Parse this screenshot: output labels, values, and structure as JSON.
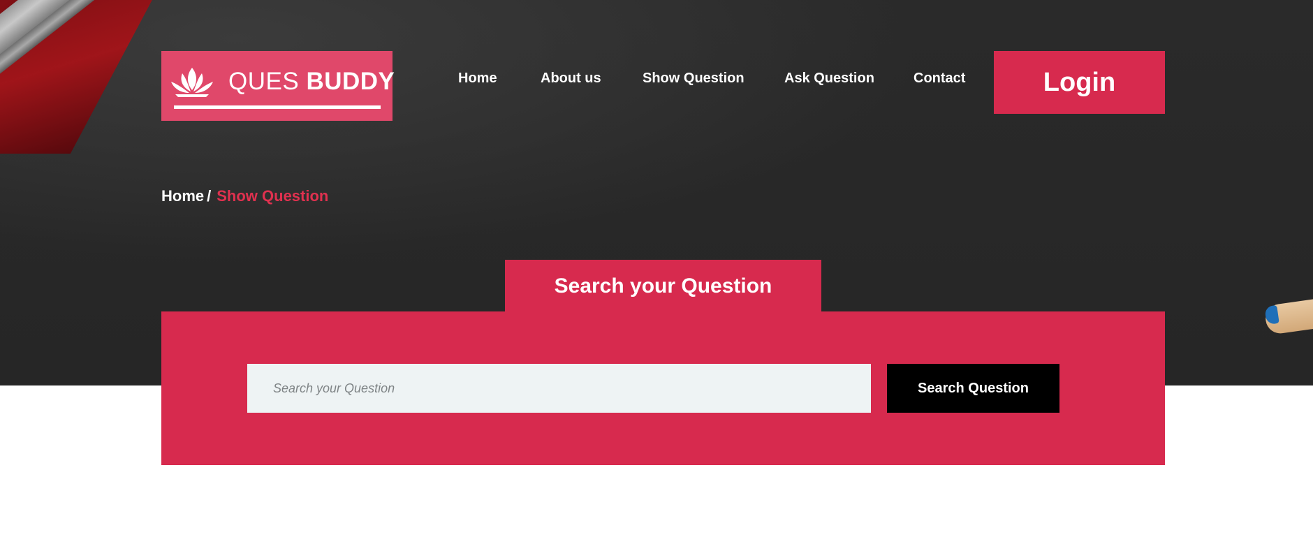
{
  "brand": {
    "name_light": "QUES",
    "name_bold": "BUDDY",
    "color": "#e0486a",
    "icon": "lotus-icon"
  },
  "nav": {
    "items": [
      {
        "label": "Home"
      },
      {
        "label": "About us"
      },
      {
        "label": "Show Question"
      },
      {
        "label": "Ask Question"
      },
      {
        "label": "Contact"
      }
    ],
    "login_label": "Login"
  },
  "breadcrumb": {
    "home": "Home",
    "separator": "/",
    "current": "Show Question"
  },
  "search": {
    "tab_title": "Search your Question",
    "placeholder": "Search your Question",
    "value": "",
    "button_label": "Search Question"
  },
  "colors": {
    "accent": "#d72a4e",
    "button_dark": "#000000",
    "input_bg": "#eef3f4",
    "hero_bg": "#262626"
  }
}
